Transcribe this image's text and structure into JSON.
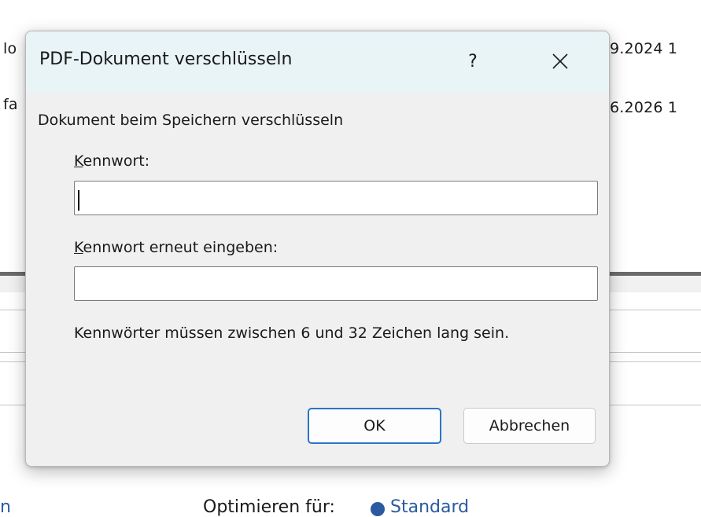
{
  "background": {
    "row1": {
      "left_text": "lo",
      "right_text": "9.2024 1"
    },
    "row2": {
      "left_text": "fa",
      "right_text": "6.2026 1"
    },
    "bottom": {
      "left_text": "n",
      "optimize_label": "Optimieren für:",
      "option_label": "Standard"
    }
  },
  "dialog": {
    "title": "PDF-Dokument verschlüsseln",
    "help_glyph": "?",
    "description": "Dokument beim Speichern verschlüsseln",
    "password": {
      "label_mnemonic": "K",
      "label_rest": "ennwort:",
      "value": ""
    },
    "password_confirm": {
      "label_mnemonic": "K",
      "label_rest": "ennwort erneut eingeben:",
      "value": ""
    },
    "hint": "Kennwörter müssen zwischen 6 und 32 Zeichen lang sein.",
    "ok_label": "OK",
    "cancel_label": "Abbrechen"
  },
  "colors": {
    "titlebar": "#e9f4f7",
    "dialog_body": "#f0f0f0",
    "accent_focus": "#2b73c9"
  },
  "icons": {
    "close": "close-icon",
    "help": "help-icon",
    "radio": "radio-selected-icon"
  }
}
